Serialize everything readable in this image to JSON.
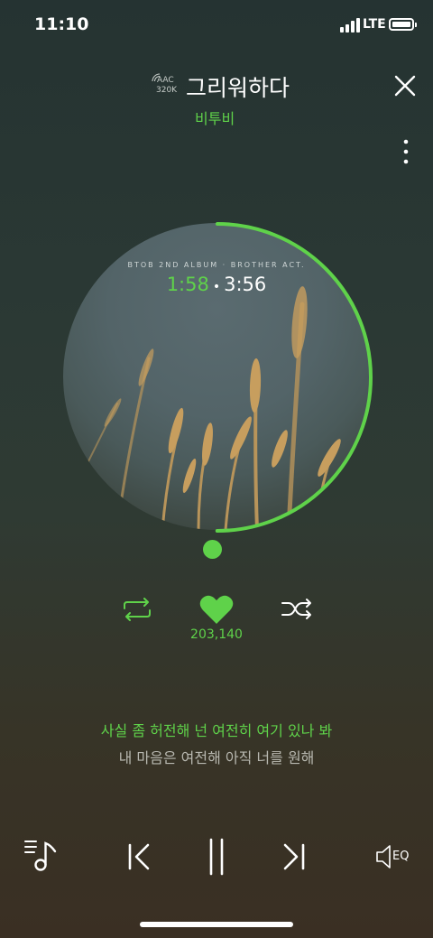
{
  "status_bar": {
    "time": "11:10",
    "network": "LTE"
  },
  "header": {
    "quality_format": "AAC",
    "quality_bitrate": "320K",
    "title": "그리워하다",
    "artist": "비투비"
  },
  "album": {
    "text": "BTOB 2ND ALBUM · BROTHER ACT.",
    "time_current": "1:58",
    "time_separator": "•",
    "time_total": "3:56",
    "progress_fraction": 0.5
  },
  "controls": {
    "like_count": "203,140"
  },
  "lyrics": {
    "current": "사실 좀 허전해 넌 여전히 여기 있나 봐",
    "next": "내 마음은 여전해 아직 너를 원해"
  },
  "bottom_bar": {
    "eq_label": "EQ"
  },
  "colors": {
    "accent": "#5fd24a"
  }
}
